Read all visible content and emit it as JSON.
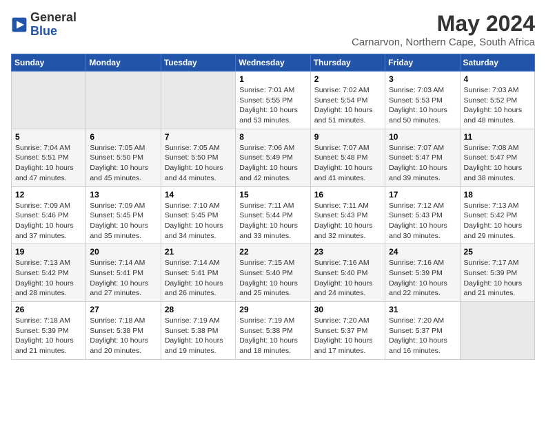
{
  "header": {
    "logo_general": "General",
    "logo_blue": "Blue",
    "month_year": "May 2024",
    "location": "Carnarvon, Northern Cape, South Africa"
  },
  "weekdays": [
    "Sunday",
    "Monday",
    "Tuesday",
    "Wednesday",
    "Thursday",
    "Friday",
    "Saturday"
  ],
  "weeks": [
    [
      {
        "day": "",
        "sunrise": "",
        "sunset": "",
        "daylight": ""
      },
      {
        "day": "",
        "sunrise": "",
        "sunset": "",
        "daylight": ""
      },
      {
        "day": "",
        "sunrise": "",
        "sunset": "",
        "daylight": ""
      },
      {
        "day": "1",
        "sunrise": "Sunrise: 7:01 AM",
        "sunset": "Sunset: 5:55 PM",
        "daylight": "Daylight: 10 hours and 53 minutes."
      },
      {
        "day": "2",
        "sunrise": "Sunrise: 7:02 AM",
        "sunset": "Sunset: 5:54 PM",
        "daylight": "Daylight: 10 hours and 51 minutes."
      },
      {
        "day": "3",
        "sunrise": "Sunrise: 7:03 AM",
        "sunset": "Sunset: 5:53 PM",
        "daylight": "Daylight: 10 hours and 50 minutes."
      },
      {
        "day": "4",
        "sunrise": "Sunrise: 7:03 AM",
        "sunset": "Sunset: 5:52 PM",
        "daylight": "Daylight: 10 hours and 48 minutes."
      }
    ],
    [
      {
        "day": "5",
        "sunrise": "Sunrise: 7:04 AM",
        "sunset": "Sunset: 5:51 PM",
        "daylight": "Daylight: 10 hours and 47 minutes."
      },
      {
        "day": "6",
        "sunrise": "Sunrise: 7:05 AM",
        "sunset": "Sunset: 5:50 PM",
        "daylight": "Daylight: 10 hours and 45 minutes."
      },
      {
        "day": "7",
        "sunrise": "Sunrise: 7:05 AM",
        "sunset": "Sunset: 5:50 PM",
        "daylight": "Daylight: 10 hours and 44 minutes."
      },
      {
        "day": "8",
        "sunrise": "Sunrise: 7:06 AM",
        "sunset": "Sunset: 5:49 PM",
        "daylight": "Daylight: 10 hours and 42 minutes."
      },
      {
        "day": "9",
        "sunrise": "Sunrise: 7:07 AM",
        "sunset": "Sunset: 5:48 PM",
        "daylight": "Daylight: 10 hours and 41 minutes."
      },
      {
        "day": "10",
        "sunrise": "Sunrise: 7:07 AM",
        "sunset": "Sunset: 5:47 PM",
        "daylight": "Daylight: 10 hours and 39 minutes."
      },
      {
        "day": "11",
        "sunrise": "Sunrise: 7:08 AM",
        "sunset": "Sunset: 5:47 PM",
        "daylight": "Daylight: 10 hours and 38 minutes."
      }
    ],
    [
      {
        "day": "12",
        "sunrise": "Sunrise: 7:09 AM",
        "sunset": "Sunset: 5:46 PM",
        "daylight": "Daylight: 10 hours and 37 minutes."
      },
      {
        "day": "13",
        "sunrise": "Sunrise: 7:09 AM",
        "sunset": "Sunset: 5:45 PM",
        "daylight": "Daylight: 10 hours and 35 minutes."
      },
      {
        "day": "14",
        "sunrise": "Sunrise: 7:10 AM",
        "sunset": "Sunset: 5:45 PM",
        "daylight": "Daylight: 10 hours and 34 minutes."
      },
      {
        "day": "15",
        "sunrise": "Sunrise: 7:11 AM",
        "sunset": "Sunset: 5:44 PM",
        "daylight": "Daylight: 10 hours and 33 minutes."
      },
      {
        "day": "16",
        "sunrise": "Sunrise: 7:11 AM",
        "sunset": "Sunset: 5:43 PM",
        "daylight": "Daylight: 10 hours and 32 minutes."
      },
      {
        "day": "17",
        "sunrise": "Sunrise: 7:12 AM",
        "sunset": "Sunset: 5:43 PM",
        "daylight": "Daylight: 10 hours and 30 minutes."
      },
      {
        "day": "18",
        "sunrise": "Sunrise: 7:13 AM",
        "sunset": "Sunset: 5:42 PM",
        "daylight": "Daylight: 10 hours and 29 minutes."
      }
    ],
    [
      {
        "day": "19",
        "sunrise": "Sunrise: 7:13 AM",
        "sunset": "Sunset: 5:42 PM",
        "daylight": "Daylight: 10 hours and 28 minutes."
      },
      {
        "day": "20",
        "sunrise": "Sunrise: 7:14 AM",
        "sunset": "Sunset: 5:41 PM",
        "daylight": "Daylight: 10 hours and 27 minutes."
      },
      {
        "day": "21",
        "sunrise": "Sunrise: 7:14 AM",
        "sunset": "Sunset: 5:41 PM",
        "daylight": "Daylight: 10 hours and 26 minutes."
      },
      {
        "day": "22",
        "sunrise": "Sunrise: 7:15 AM",
        "sunset": "Sunset: 5:40 PM",
        "daylight": "Daylight: 10 hours and 25 minutes."
      },
      {
        "day": "23",
        "sunrise": "Sunrise: 7:16 AM",
        "sunset": "Sunset: 5:40 PM",
        "daylight": "Daylight: 10 hours and 24 minutes."
      },
      {
        "day": "24",
        "sunrise": "Sunrise: 7:16 AM",
        "sunset": "Sunset: 5:39 PM",
        "daylight": "Daylight: 10 hours and 22 minutes."
      },
      {
        "day": "25",
        "sunrise": "Sunrise: 7:17 AM",
        "sunset": "Sunset: 5:39 PM",
        "daylight": "Daylight: 10 hours and 21 minutes."
      }
    ],
    [
      {
        "day": "26",
        "sunrise": "Sunrise: 7:18 AM",
        "sunset": "Sunset: 5:39 PM",
        "daylight": "Daylight: 10 hours and 21 minutes."
      },
      {
        "day": "27",
        "sunrise": "Sunrise: 7:18 AM",
        "sunset": "Sunset: 5:38 PM",
        "daylight": "Daylight: 10 hours and 20 minutes."
      },
      {
        "day": "28",
        "sunrise": "Sunrise: 7:19 AM",
        "sunset": "Sunset: 5:38 PM",
        "daylight": "Daylight: 10 hours and 19 minutes."
      },
      {
        "day": "29",
        "sunrise": "Sunrise: 7:19 AM",
        "sunset": "Sunset: 5:38 PM",
        "daylight": "Daylight: 10 hours and 18 minutes."
      },
      {
        "day": "30",
        "sunrise": "Sunrise: 7:20 AM",
        "sunset": "Sunset: 5:37 PM",
        "daylight": "Daylight: 10 hours and 17 minutes."
      },
      {
        "day": "31",
        "sunrise": "Sunrise: 7:20 AM",
        "sunset": "Sunset: 5:37 PM",
        "daylight": "Daylight: 10 hours and 16 minutes."
      },
      {
        "day": "",
        "sunrise": "",
        "sunset": "",
        "daylight": ""
      }
    ]
  ]
}
